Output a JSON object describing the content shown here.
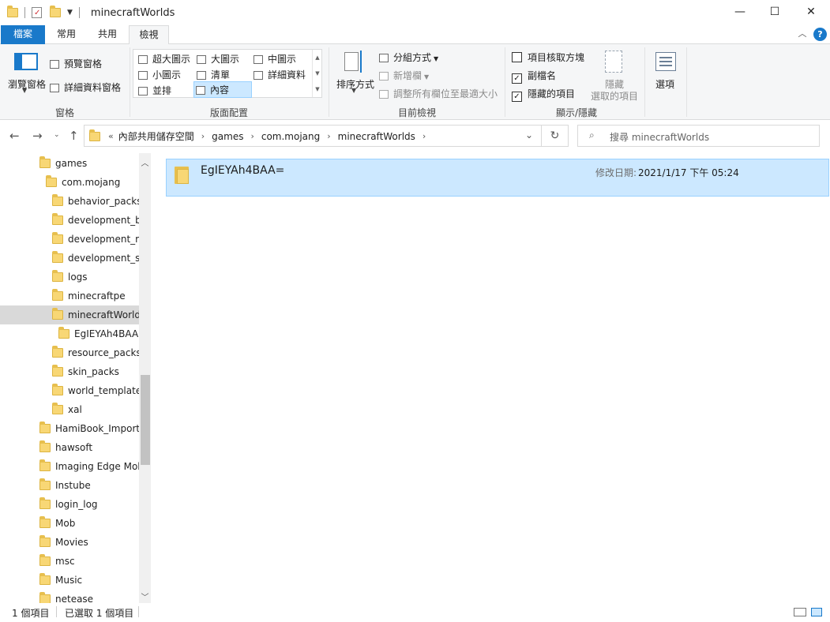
{
  "window": {
    "title": "minecraftWorlds",
    "minimize": "—",
    "maximize": "☐",
    "close": "✕"
  },
  "tabs": {
    "file": "檔案",
    "home": "常用",
    "share": "共用",
    "view": "檢視",
    "collapse": "︿",
    "help": "?"
  },
  "ribbon": {
    "panes": {
      "nav_pane": "瀏覽窗格",
      "preview_pane": "預覽窗格",
      "details_pane": "詳細資料窗格",
      "label": "窗格"
    },
    "layout": {
      "extra_large": "超大圖示",
      "large": "大圖示",
      "medium": "中圖示",
      "small": "小圖示",
      "list": "清單",
      "details": "詳細資料",
      "tiles": "並排",
      "content": "內容",
      "label": "版面配置"
    },
    "current_view": {
      "sort_by": "排序方式",
      "group_by": "分組方式",
      "add_columns": "新增欄",
      "size_all_columns": "調整所有欄位至最適大小",
      "label": "目前檢視"
    },
    "show_hide": {
      "item_checkboxes": "項目核取方塊",
      "file_extensions": "副檔名",
      "hidden_items": "隱藏的項目",
      "hide_selected_line1": "隱藏",
      "hide_selected_line2": "選取的項目",
      "label": "顯示/隱藏",
      "checked": [
        "false",
        "true",
        "true"
      ]
    },
    "options": "選項"
  },
  "address": {
    "overflow": "«",
    "crumbs": [
      "內部共用儲存空間",
      "games",
      "com.mojang",
      "minecraftWorlds"
    ],
    "search_placeholder": "搜尋 minecraftWorlds"
  },
  "tree": [
    {
      "label": "games"
    },
    {
      "label": "com.mojang"
    },
    {
      "label": "behavior_packs"
    },
    {
      "label": "development_b"
    },
    {
      "label": "development_re"
    },
    {
      "label": "development_sk"
    },
    {
      "label": "logs"
    },
    {
      "label": "minecraftpe"
    },
    {
      "label": "minecraftWorlds"
    },
    {
      "label": "EgIEYAh4BAA="
    },
    {
      "label": "resource_packs"
    },
    {
      "label": "skin_packs"
    },
    {
      "label": "world_template"
    },
    {
      "label": "xal"
    },
    {
      "label": "HamiBook_Import"
    },
    {
      "label": "hawsoft"
    },
    {
      "label": "Imaging Edge Mol"
    },
    {
      "label": "Instube"
    },
    {
      "label": "login_log"
    },
    {
      "label": "Mob"
    },
    {
      "label": "Movies"
    },
    {
      "label": "msc"
    },
    {
      "label": "Music"
    },
    {
      "label": "netease"
    }
  ],
  "content": {
    "items": [
      {
        "name": "EgIEYAh4BAA=",
        "modified_label": "修改日期:",
        "modified_value": "2021/1/17 下午 05:24"
      }
    ]
  },
  "status": {
    "item_count": "1 個項目",
    "selected": "已選取 1 個項目"
  }
}
